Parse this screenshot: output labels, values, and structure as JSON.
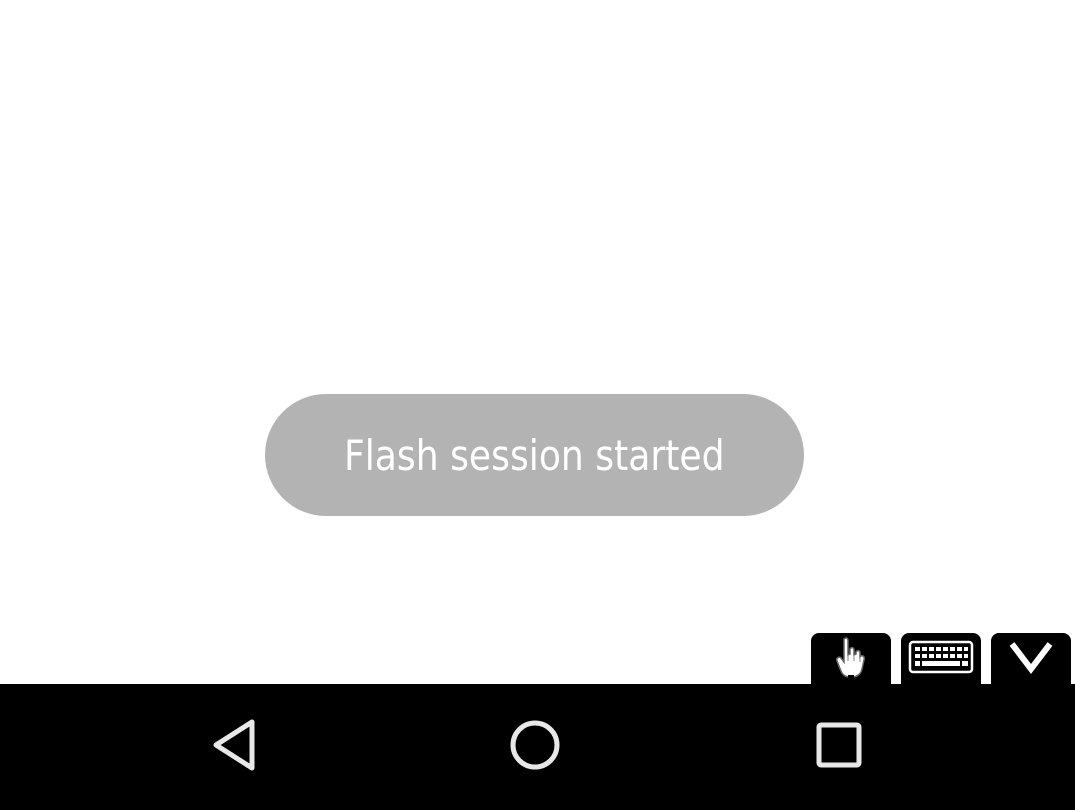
{
  "toast": {
    "message": "Flash session started"
  },
  "tool_tabs": [
    {
      "name": "touch-mode",
      "icon": "pointing-hand-icon"
    },
    {
      "name": "keyboard",
      "icon": "keyboard-icon"
    },
    {
      "name": "collapse",
      "icon": "chevron-down-icon"
    }
  ],
  "navbar": {
    "back_icon": "triangle-back-icon",
    "home_icon": "circle-home-icon",
    "recents_icon": "square-recents-icon"
  },
  "colors": {
    "background": "#ffffff",
    "toast_bg": "#b3b3b3",
    "toast_text": "#ffffff",
    "navbar_bg": "#000000",
    "nav_icon": "#e8e8e8"
  }
}
